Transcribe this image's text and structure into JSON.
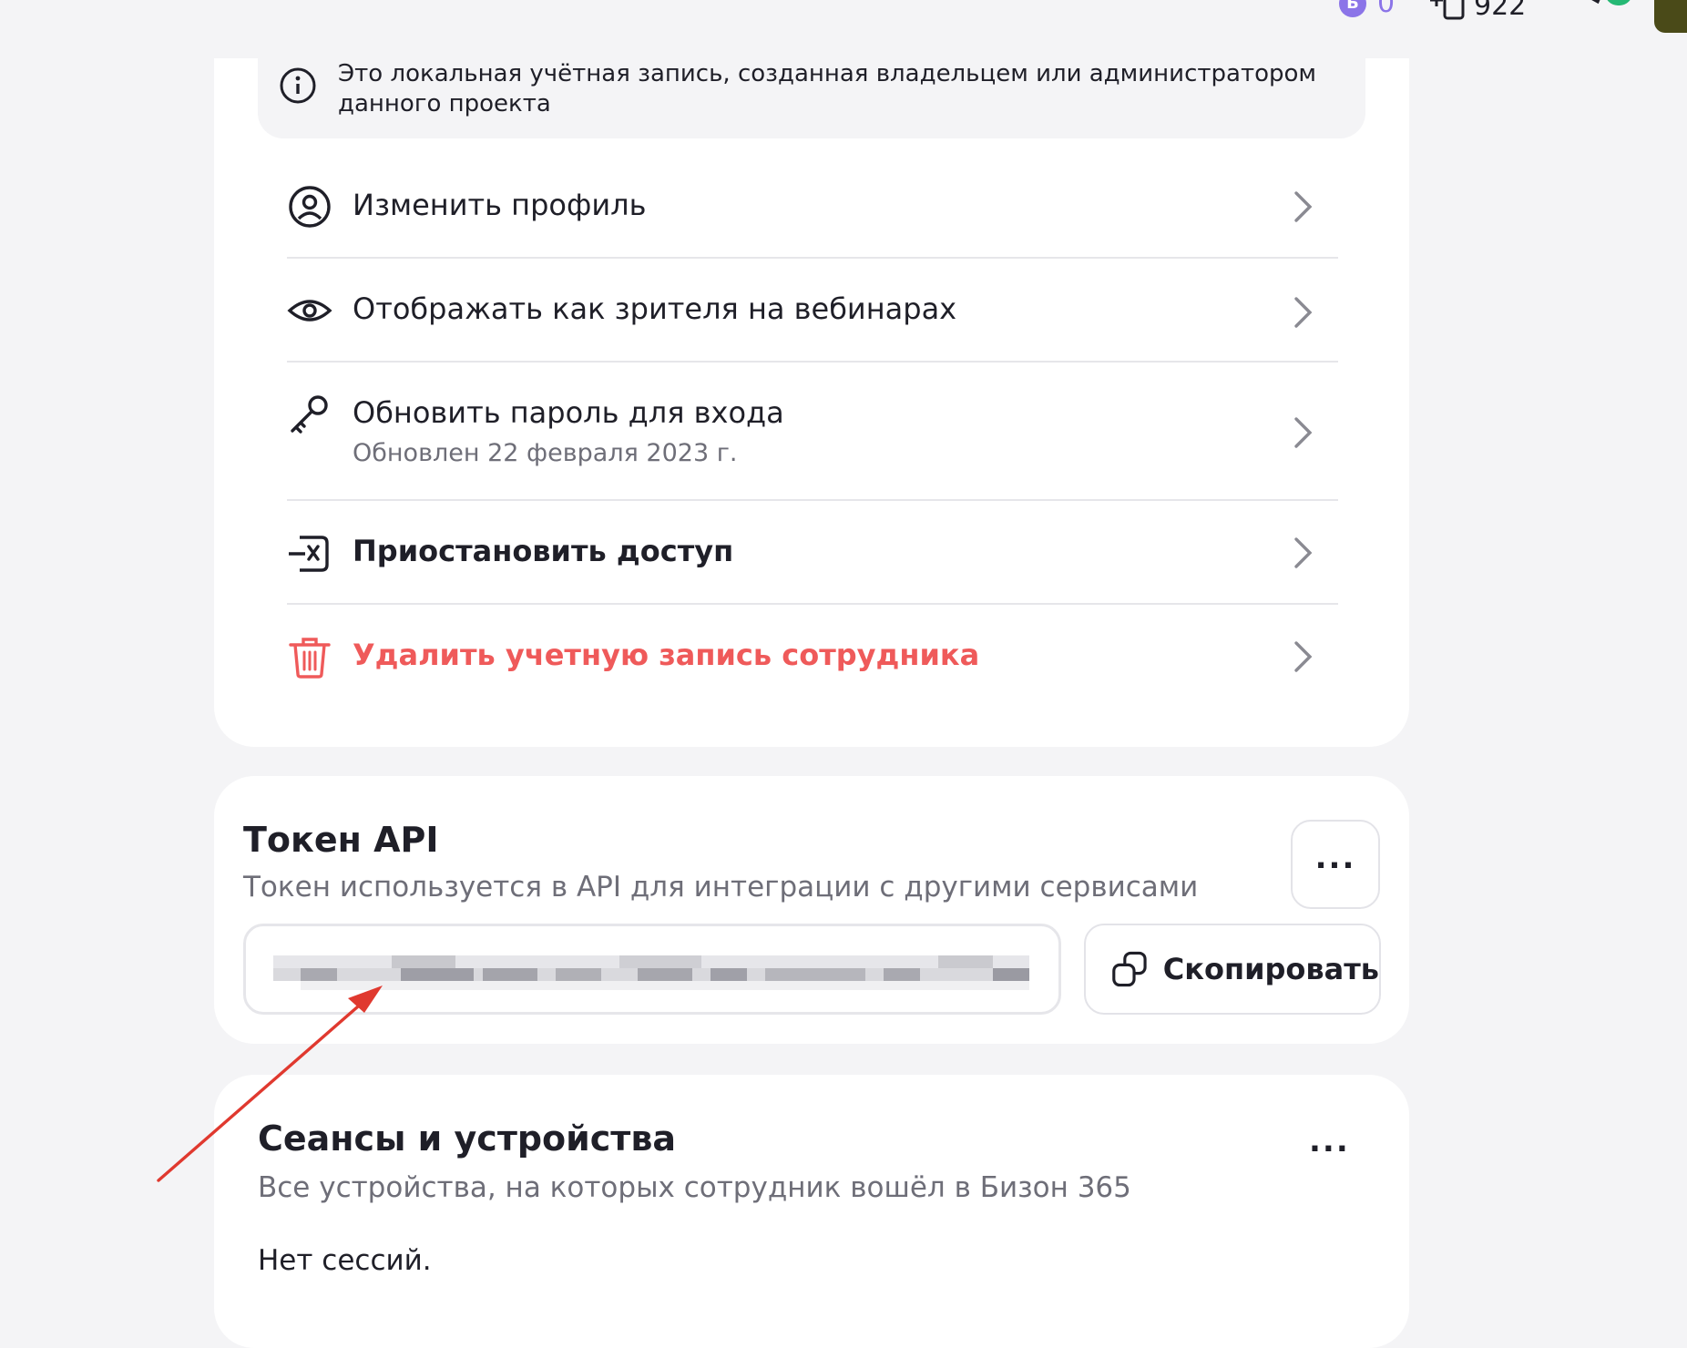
{
  "topbar": {
    "coin_symbol": "Б",
    "coin_value": "0",
    "add_users_value": "922"
  },
  "profile": {
    "notice_text": "Это локальная учётная запись, созданная владельцем или администратором данного проекта",
    "menu": [
      {
        "label": "Изменить профиль",
        "icon": "user-circle-icon"
      },
      {
        "label": "Отображать как зрителя на вебинарах",
        "icon": "eye-icon"
      },
      {
        "label": "Обновить пароль для входа",
        "sub": "Обновлен 22 февраля 2023 г.",
        "icon": "key-icon"
      },
      {
        "label": "Приостановить доступ",
        "icon": "suspend-icon"
      },
      {
        "label": "Удалить учетную запись сотрудника",
        "icon": "trash-icon"
      }
    ]
  },
  "token": {
    "title": "Токен API",
    "subtitle": "Токен используется в API для интеграции с другими сервисами",
    "more_label": "...",
    "copy_label": "Скопировать"
  },
  "sessions": {
    "title": "Сеансы и устройства",
    "subtitle": "Все устройства, на которых сотрудник вошёл в Бизон 365",
    "more_label": "...",
    "empty": "Нет сессий."
  },
  "colors": {
    "danger": "#ef5a5a",
    "accent_coin": "#8b74e8",
    "annotation_arrow": "#e0392f",
    "badge": "#25b874"
  }
}
